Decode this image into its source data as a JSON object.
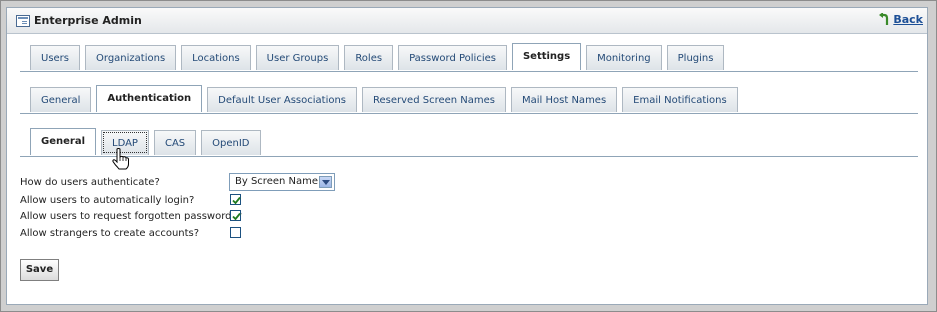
{
  "window": {
    "title": "Enterprise Admin",
    "back_label": "Back"
  },
  "primary_tabs": [
    {
      "label": "Users"
    },
    {
      "label": "Organizations"
    },
    {
      "label": "Locations"
    },
    {
      "label": "User Groups"
    },
    {
      "label": "Roles"
    },
    {
      "label": "Password Policies"
    },
    {
      "label": "Settings",
      "selected": true
    },
    {
      "label": "Monitoring"
    },
    {
      "label": "Plugins"
    }
  ],
  "settings_tabs": [
    {
      "label": "General"
    },
    {
      "label": "Authentication",
      "selected": true
    },
    {
      "label": "Default User Associations"
    },
    {
      "label": "Reserved Screen Names"
    },
    {
      "label": "Mail Host Names"
    },
    {
      "label": "Email Notifications"
    }
  ],
  "auth_tabs": [
    {
      "label": "General",
      "selected": true
    },
    {
      "label": "LDAP",
      "focused": true
    },
    {
      "label": "CAS"
    },
    {
      "label": "OpenID"
    }
  ],
  "form": {
    "authenticate_label": "How do users authenticate?",
    "authenticate_value": "By Screen Name",
    "auto_login_label": "Allow users to automatically login?",
    "auto_login_checked": true,
    "forgot_password_label": "Allow users to request forgotten passwords?",
    "forgot_password_checked": true,
    "strangers_label": "Allow strangers to create accounts?",
    "strangers_checked": false,
    "save_label": "Save"
  },
  "colors": {
    "link": "#1c4f96",
    "tab_text": "#244a77",
    "checkmark": "#1f7a1f",
    "border": "#8fa4b7"
  },
  "icons": {
    "portlet": "portlet-icon",
    "back": "back-arrow-icon",
    "cursor": "hand-cursor-icon"
  }
}
